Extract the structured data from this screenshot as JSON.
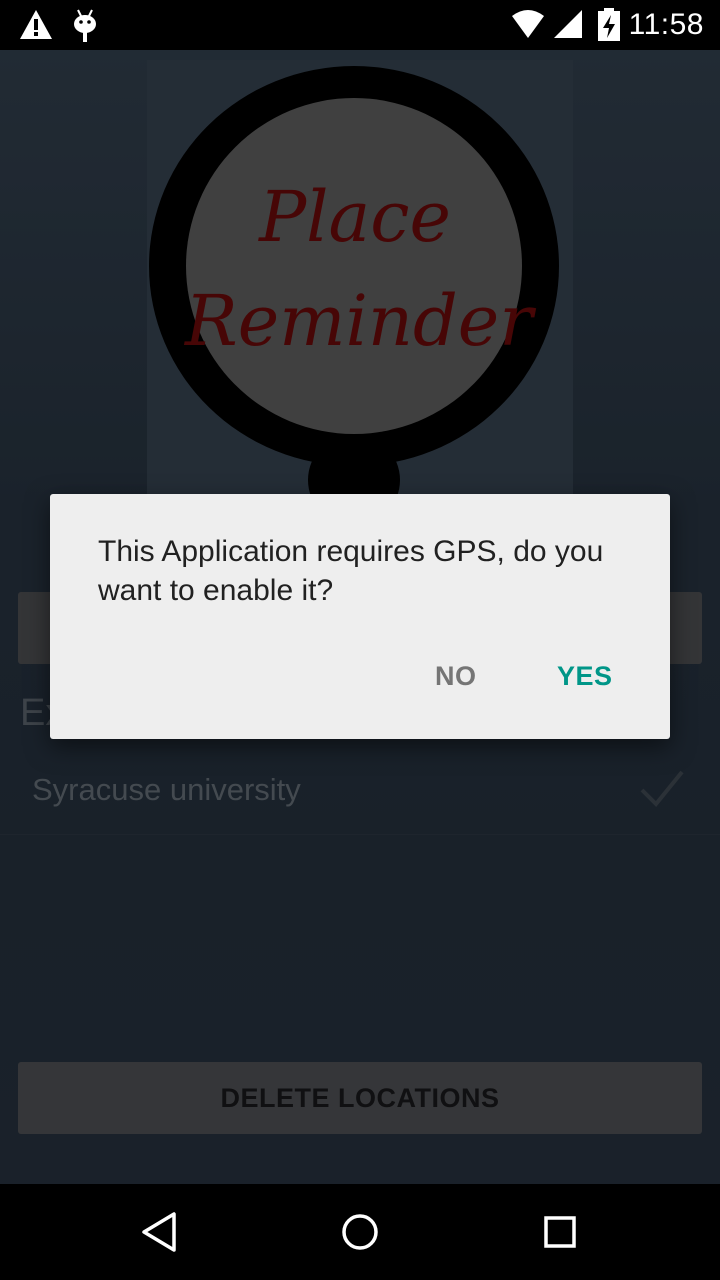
{
  "status_bar": {
    "time": "11:58",
    "icons": [
      "warning-icon",
      "android-debug-icon",
      "wifi-icon",
      "signal-icon",
      "battery-charging-icon"
    ]
  },
  "app": {
    "logo_line1": "Place",
    "logo_line2": "Reminder",
    "section_label": "Ex",
    "location_item": "Syracuse university",
    "delete_button": "DELETE LOCATIONS"
  },
  "dialog": {
    "message": "This Application requires GPS, do you want to enable it?",
    "no_label": "NO",
    "yes_label": "YES"
  },
  "nav_bar": {
    "icons": [
      "back-icon",
      "home-icon",
      "recents-icon"
    ]
  },
  "colors": {
    "accent": "#009688",
    "logo_text": "#7a0b0b",
    "dialog_bg": "#eeeeee"
  }
}
